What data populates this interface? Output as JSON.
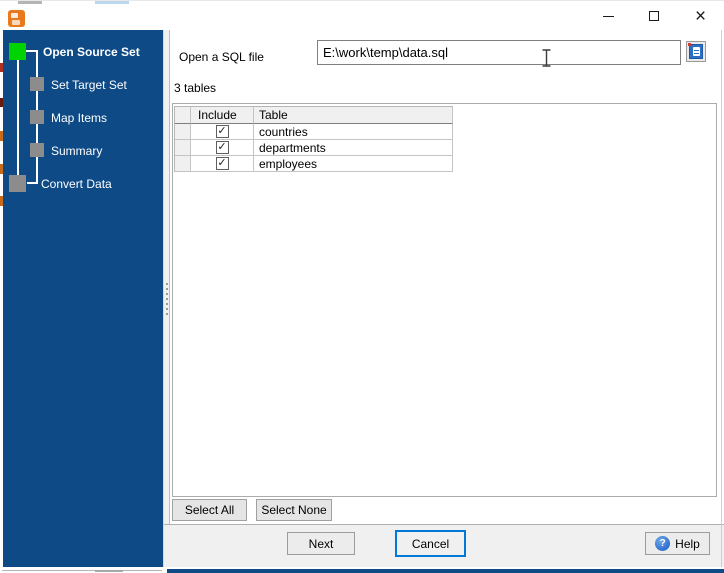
{
  "titlebar": {
    "close_glyph": "×"
  },
  "sidebar": {
    "steps": [
      {
        "label": "Open Source Set",
        "active": true
      },
      {
        "label": "Set Target Set",
        "active": false
      },
      {
        "label": "Map Items",
        "active": false
      },
      {
        "label": "Summary",
        "active": false
      },
      {
        "label": "Convert Data",
        "active": false
      }
    ]
  },
  "main": {
    "file_label": "Open a SQL file",
    "file_path": "E:\\work\\temp\\data.sql",
    "tables_count": "3 tables",
    "table": {
      "columns": [
        "Include",
        "Table"
      ],
      "check_glyph": "✓",
      "rows": [
        {
          "include": true,
          "name": "countries"
        },
        {
          "include": true,
          "name": "departments"
        },
        {
          "include": true,
          "name": "employees"
        }
      ]
    },
    "select_all": "Select All",
    "select_none": "Select None"
  },
  "footer": {
    "next": "Next",
    "cancel": "Cancel",
    "help": "Help",
    "help_glyph": "?"
  },
  "colors": {
    "sidebar_bg": "#0d4a86",
    "active_step": "#00d400",
    "pending_step": "#8c8c8c",
    "accent": "#0078d7",
    "app_icon": "#e8791e"
  }
}
